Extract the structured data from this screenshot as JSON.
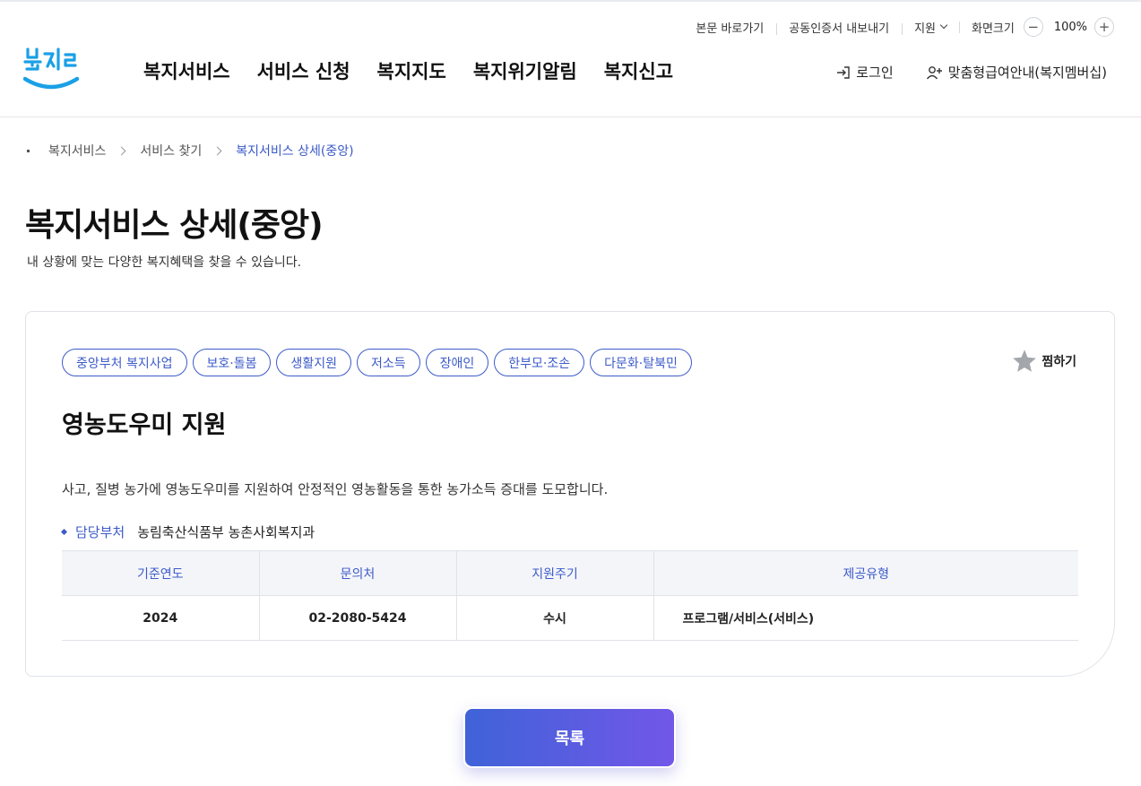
{
  "utility": {
    "skip_to_content": "본문 바로가기",
    "cert_export": "공동인증서 내보내기",
    "support": "지원",
    "screen_size": "화면크기",
    "zoom": "100%",
    "zoom_out": "−",
    "zoom_in": "+"
  },
  "logo": {
    "text": "복지로",
    "color": "#1aa0e6"
  },
  "nav": {
    "items": [
      "복지서비스",
      "서비스 신청",
      "복지지도",
      "복지위기알림",
      "복지신고"
    ]
  },
  "header_right": {
    "login": "로그인",
    "membership": "맞춤형급여안내(복지멤버십)"
  },
  "breadcrumb": {
    "items": [
      "복지서비스",
      "서비스 찾기",
      "복지서비스 상세(중앙)"
    ]
  },
  "page": {
    "title": "복지서비스 상세(중앙)",
    "description": "내 상황에 맞는 다양한 복지혜택을 찾을 수 있습니다."
  },
  "service": {
    "tags": [
      "중앙부처 복지사업",
      "보호·돌봄",
      "생활지원",
      "저소득",
      "장애인",
      "한부모·조손",
      "다문화·탈북민"
    ],
    "favorite_label": "찜하기",
    "title": "영농도우미 지원",
    "description": "사고, 질병 농가에 영농도우미를 지원하여 안정적인 영농활동을 통한 농가소득 증대를 도모합니다.",
    "department_label": "담당부처",
    "department": "농림축산식품부 농촌사회복지과",
    "table": {
      "headers": [
        "기준연도",
        "문의처",
        "지원주기",
        "제공유형"
      ],
      "row": [
        "2024",
        "02-2080-5424",
        "수시",
        "프로그램/서비스(서비스)"
      ]
    }
  },
  "list_button": "목록",
  "colors": {
    "accent": "#3d5bc9",
    "button_start": "#3f63d8",
    "button_end": "#7257e8"
  }
}
